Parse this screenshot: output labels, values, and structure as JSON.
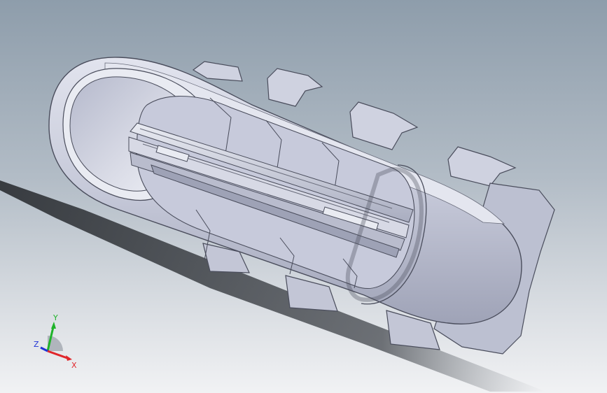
{
  "view": {
    "background_top": "#8e9dab",
    "background_bottom": "#f1f2f4",
    "model_color": "#c9ccdb",
    "edge_color": "#4a4d5c",
    "shadow_color": "#1e2124"
  },
  "triad": {
    "x_label": "X",
    "y_label": "Y",
    "z_label": "Z",
    "x_color": "#e0262b",
    "y_color": "#1fb32a",
    "z_color": "#2033d6"
  }
}
